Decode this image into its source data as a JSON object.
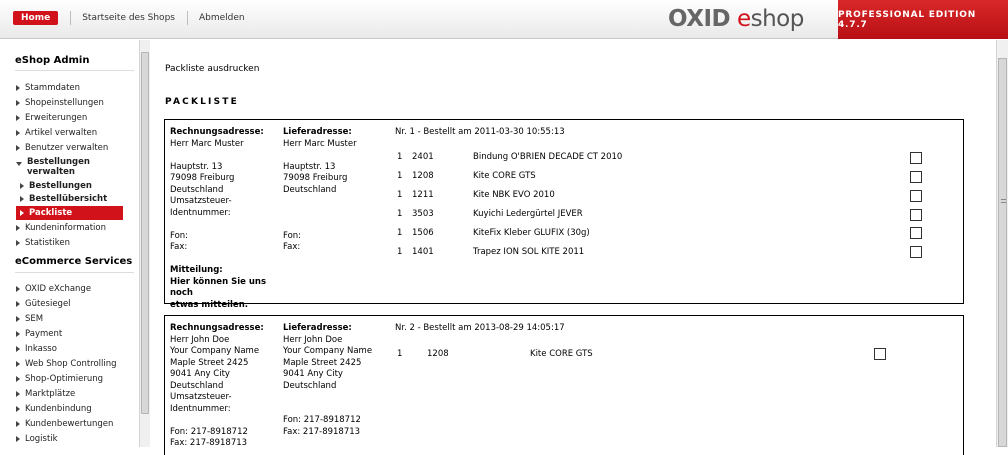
{
  "topbar": {
    "home": "Home",
    "shop_start": "Startseite des Shops",
    "logout": "Abmelden",
    "logo_oxid": "OXID",
    "logo_e": "e",
    "logo_shop": "shop",
    "edition": "PROFESSIONAL EDITION 4.7.7"
  },
  "sidebar": {
    "title_admin": "eShop Admin",
    "admin_items": [
      "Stammdaten",
      "Shopeinstellungen",
      "Erweiterungen",
      "Artikel verwalten",
      "Benutzer verwalten"
    ],
    "orders_label_1": "Bestellungen",
    "orders_label_2": "verwalten",
    "orders_sub": [
      "Bestellungen",
      "Bestellübersicht",
      "Packliste"
    ],
    "after_items": [
      "Kundeninformation",
      "Statistiken"
    ],
    "title_services": "eCommerce Services",
    "service_items": [
      "OXID eXchange",
      "Gütesiegel",
      "SEM",
      "Payment",
      "Inkasso",
      "Web Shop Controlling",
      "Shop-Optimierung",
      "Marktplätze",
      "Kundenbindung",
      "Kundenbewertungen",
      "Logistik"
    ]
  },
  "main": {
    "page_title": "Packliste ausdrucken",
    "section": "PACKLISTE",
    "orders": [
      {
        "billing_label": "Rechnungsadresse:",
        "billing_name": "Herr Marc Muster",
        "billing_company": "",
        "billing_street": "Hauptstr. 13",
        "billing_city": "79098 Freiburg",
        "billing_country": "Deutschland",
        "vat_1": "Umsatzsteuer-",
        "vat_2": "Identnummer:",
        "fon_b": "Fon:",
        "fax_b": "Fax:",
        "delivery_label": "Lieferadresse:",
        "delivery_name": "Herr Marc Muster",
        "delivery_company": "",
        "delivery_street": "Hauptstr. 13",
        "delivery_city": "79098 Freiburg",
        "delivery_country": "Deutschland",
        "fon_d": "Fon:",
        "fax_d": "Fax:",
        "message_label": "Mitteilung:",
        "message_1": "Hier können Sie uns noch",
        "message_2": "etwas mitteilen.",
        "header": "Nr. 1 - Bestellt am 2011-03-30 10:55:13",
        "items": [
          {
            "qty": "1",
            "sku": "2401",
            "name": "Bindung O'BRIEN DECADE CT 2010"
          },
          {
            "qty": "1",
            "sku": "1208",
            "name": "Kite CORE GTS"
          },
          {
            "qty": "1",
            "sku": "1211",
            "name": "Kite NBK EVO 2010"
          },
          {
            "qty": "1",
            "sku": "3503",
            "name": "Kuyichi Ledergürtel JEVER"
          },
          {
            "qty": "1",
            "sku": "1506",
            "name": "KiteFix Kleber GLUFIX (30g)"
          },
          {
            "qty": "1",
            "sku": "1401",
            "name": "Trapez ION SOL KITE 2011"
          }
        ]
      },
      {
        "billing_label": "Rechnungsadresse:",
        "billing_name": "Herr John Doe",
        "billing_company": "Your Company Name",
        "billing_street": "Maple Street 2425",
        "billing_city": "9041 Any City",
        "billing_country": "Deutschland",
        "vat_1": "Umsatzsteuer-",
        "vat_2": "Identnummer:",
        "fon_b": "Fon: 217-8918712",
        "fax_b": "Fax: 217-8918713",
        "delivery_label": "Lieferadresse:",
        "delivery_name": "Herr John Doe",
        "delivery_company": "Your Company Name",
        "delivery_street": "Maple Street 2425",
        "delivery_city": "9041 Any City",
        "delivery_country": "Deutschland",
        "fon_d": "Fon: 217-8918712",
        "fax_d": "Fax: 217-8918713",
        "header": "Nr. 2 - Bestellt am 2013-08-29 14:05:17",
        "items": [
          {
            "qty": "1",
            "sku": "1208",
            "name": "Kite CORE GTS"
          }
        ]
      }
    ]
  },
  "colors": {
    "brand_red": "#d1121b"
  }
}
